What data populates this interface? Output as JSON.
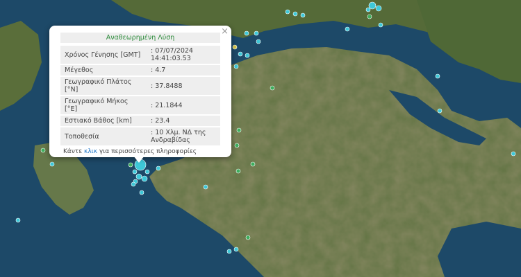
{
  "popup": {
    "title": "Αναθεωρημένη Λύση",
    "close": "×",
    "rows": [
      {
        "label": "Χρόνος Γένησης [GMT]",
        "value": ": 07/07/2024 14:41:03.53"
      },
      {
        "label": "Μέγεθος",
        "value": ": 4.7"
      },
      {
        "label": "Γεωγραφικό Πλάτος [°N]",
        "value": ": 37.8488"
      },
      {
        "label": "Γεωγραφικό Μήκος [°E]",
        "value": ": 21.1844"
      },
      {
        "label": "Εστιακό Βάθος [km]",
        "value": ": 23.4"
      },
      {
        "label": "Τοποθεσία",
        "value": ": 10 Χλμ. ΝΔ της Ανδραβίδας"
      }
    ],
    "footer_pre": "Κάντε ",
    "footer_link": "κλικ",
    "footer_post": " για περισσότερες πληροφορίες"
  },
  "colors": {
    "sea": "#1d4968",
    "land": "#5a6e3a",
    "quake_cyan": "#3ec8d8",
    "quake_green": "#3fae5e",
    "quake_yellow": "#d8c84a"
  }
}
